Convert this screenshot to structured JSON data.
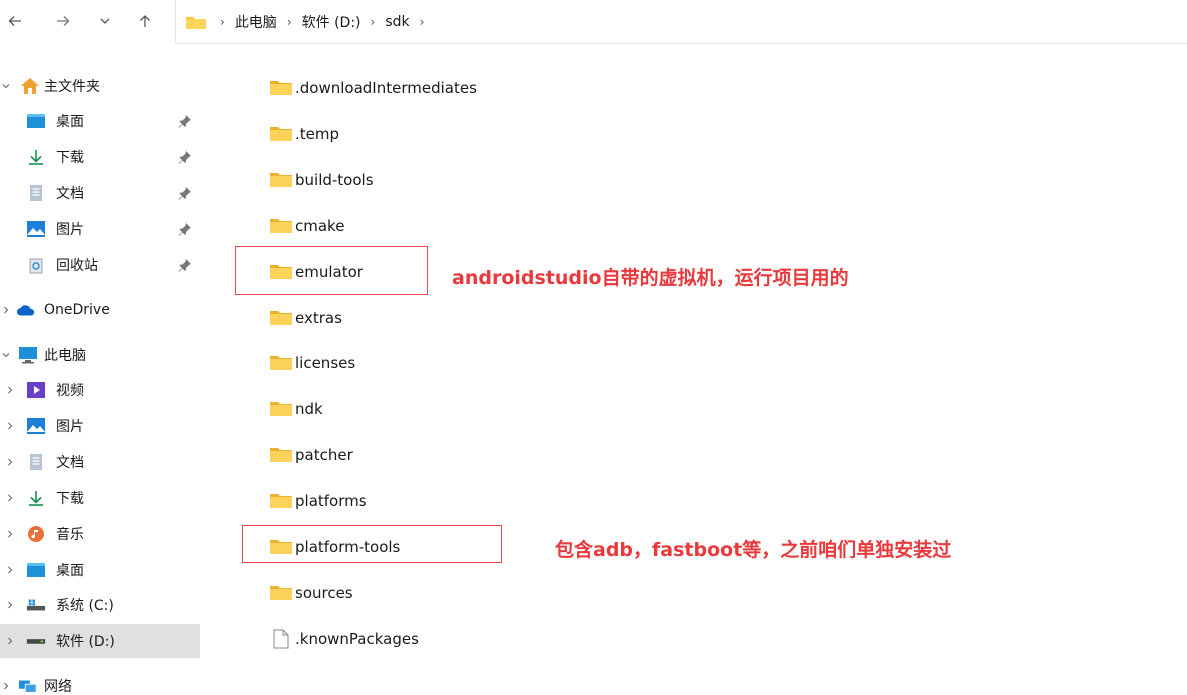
{
  "breadcrumbs": [
    "此电脑",
    "软件 (D:)",
    "sdk"
  ],
  "sidebar": {
    "quick_access": {
      "label": "主文件夹",
      "items": [
        {
          "label": "桌面",
          "icon": "desktop-icon"
        },
        {
          "label": "下载",
          "icon": "download-icon"
        },
        {
          "label": "文档",
          "icon": "document-icon"
        },
        {
          "label": "图片",
          "icon": "pictures-icon"
        },
        {
          "label": "回收站",
          "icon": "recycle-bin-icon"
        }
      ]
    },
    "onedrive": {
      "label": "OneDrive"
    },
    "this_pc": {
      "label": "此电脑",
      "items": [
        {
          "label": "视频",
          "icon": "videos-icon"
        },
        {
          "label": "图片",
          "icon": "pictures-icon"
        },
        {
          "label": "文档",
          "icon": "document-icon"
        },
        {
          "label": "下载",
          "icon": "download-icon"
        },
        {
          "label": "音乐",
          "icon": "music-icon"
        },
        {
          "label": "桌面",
          "icon": "desktop-icon"
        },
        {
          "label": "系统 (C:)",
          "icon": "drive-c-icon"
        },
        {
          "label": "软件 (D:)",
          "icon": "drive-d-icon",
          "selected": true
        }
      ]
    },
    "network": {
      "label": "网络"
    }
  },
  "files": [
    {
      "name": ".downloadIntermediates",
      "type": "folder"
    },
    {
      "name": ".temp",
      "type": "folder"
    },
    {
      "name": "build-tools",
      "type": "folder"
    },
    {
      "name": "cmake",
      "type": "folder"
    },
    {
      "name": "emulator",
      "type": "folder"
    },
    {
      "name": "extras",
      "type": "folder"
    },
    {
      "name": "licenses",
      "type": "folder"
    },
    {
      "name": "ndk",
      "type": "folder"
    },
    {
      "name": "patcher",
      "type": "folder"
    },
    {
      "name": "platforms",
      "type": "folder"
    },
    {
      "name": "platform-tools",
      "type": "folder"
    },
    {
      "name": "sources",
      "type": "folder"
    },
    {
      "name": ".knownPackages",
      "type": "file"
    }
  ],
  "annotations": {
    "emulator_note": "androidstudio自带的虚拟机，运行项目用的",
    "platform_tools_note": "包含adb，fastboot等，之前咱们单独安装过"
  },
  "colors": {
    "annotation": "#e8393d",
    "folder": "#f8c43c",
    "selected_bg": "#e0e0e0"
  }
}
